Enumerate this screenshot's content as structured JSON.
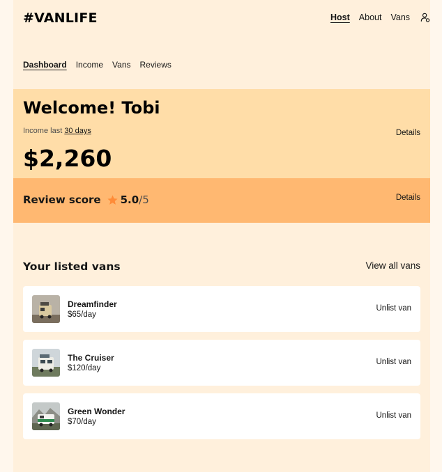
{
  "header": {
    "logo": "#VANLIFE",
    "nav": [
      {
        "label": "Host",
        "active": true
      },
      {
        "label": "About",
        "active": false
      },
      {
        "label": "Vans",
        "active": false
      }
    ],
    "user_icon": "user-circle-icon"
  },
  "host_nav": [
    {
      "label": "Dashboard",
      "active": true
    },
    {
      "label": "Income",
      "active": false
    },
    {
      "label": "Vans",
      "active": false
    },
    {
      "label": "Reviews",
      "active": false
    }
  ],
  "income": {
    "welcome": "Welcome! Tobi",
    "label_prefix": "Income last ",
    "label_period": "30 days",
    "amount": "$2,260",
    "details": "Details"
  },
  "review": {
    "title": "Review score",
    "star_icon": "star-icon",
    "score": "5.0",
    "out_of": "/5",
    "details": "Details"
  },
  "listed": {
    "title": "Your listed vans",
    "view_all": "View all vans",
    "vans": [
      {
        "name": "Dreamfinder",
        "price": "$65/day",
        "action": "Unlist van"
      },
      {
        "name": "The Cruiser",
        "price": "$120/day",
        "action": "Unlist van"
      },
      {
        "name": "Green Wonder",
        "price": "$70/day",
        "action": "Unlist van"
      }
    ]
  },
  "colors": {
    "page_bg": "#FFF0DC",
    "income_bg": "#FFDDA8",
    "review_bg": "#FFB871",
    "star": "#FF8C38"
  }
}
